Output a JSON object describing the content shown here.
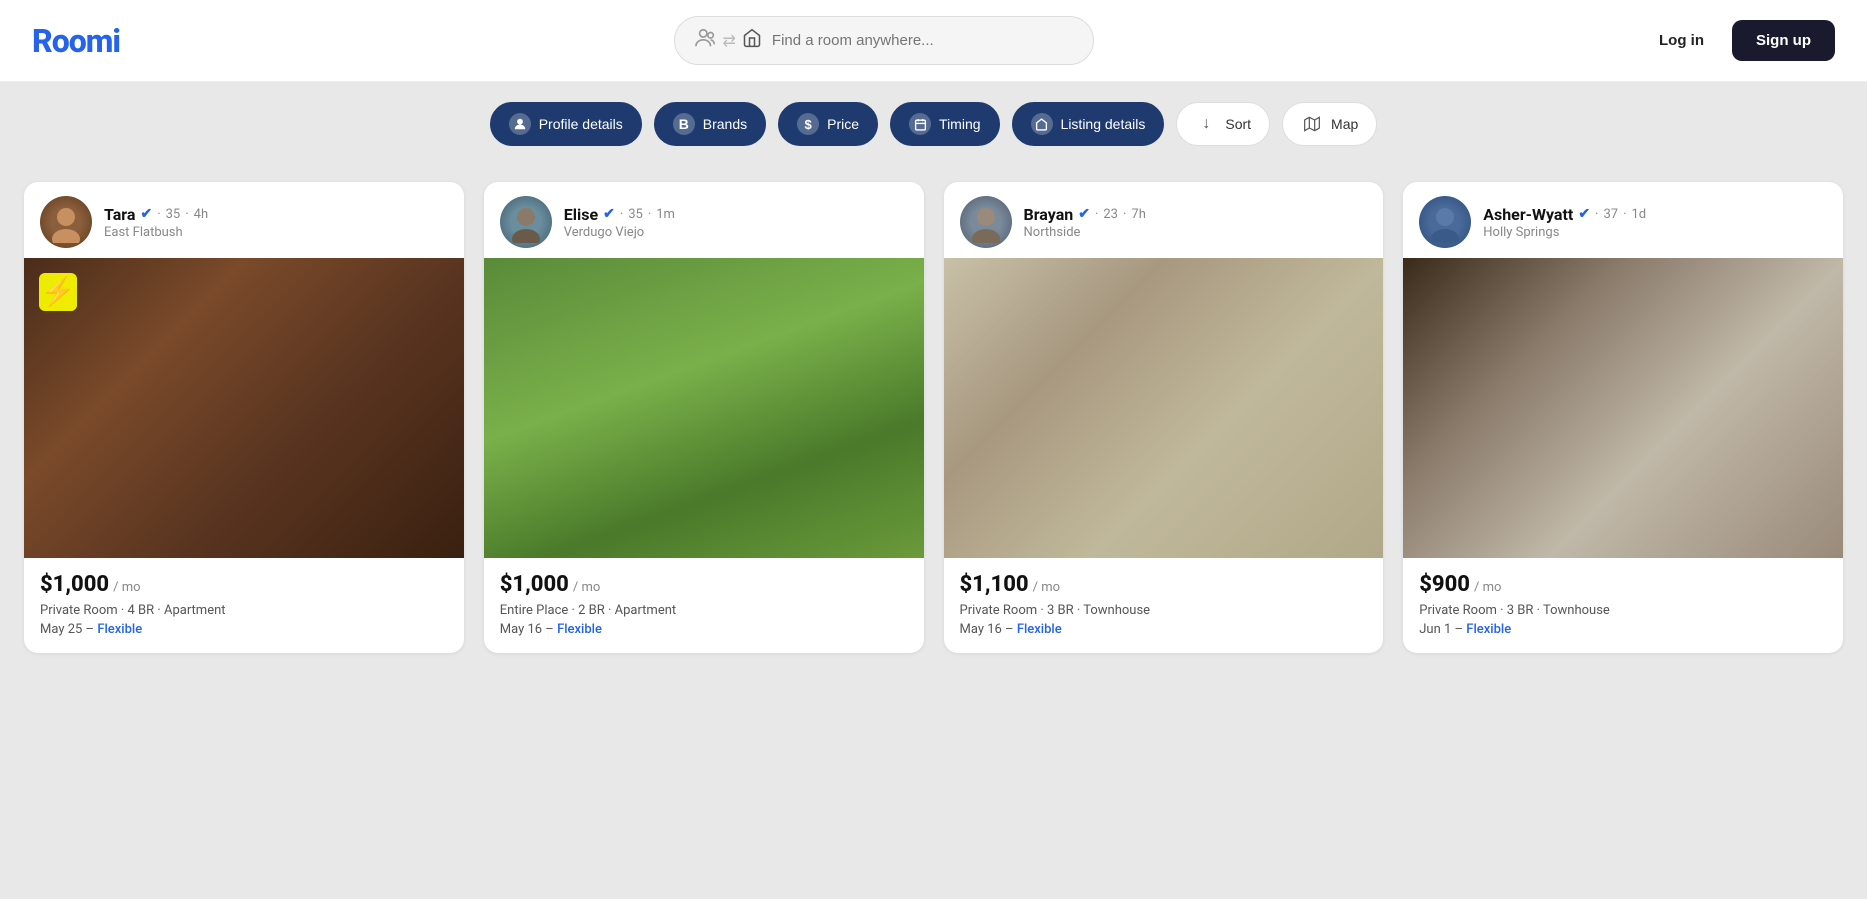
{
  "header": {
    "logo": "Roomi",
    "search_placeholder": "Find a room anywhere...",
    "login_label": "Log in",
    "signup_label": "Sign up"
  },
  "filters": [
    {
      "id": "profile",
      "label": "Profile details",
      "icon": "👤",
      "active": true
    },
    {
      "id": "brands",
      "label": "Brands",
      "icon": "B",
      "active": true
    },
    {
      "id": "price",
      "label": "Price",
      "icon": "$",
      "active": true
    },
    {
      "id": "timing",
      "label": "Timing",
      "icon": "📅",
      "active": true
    },
    {
      "id": "listing",
      "label": "Listing details",
      "icon": "🏠",
      "active": true
    },
    {
      "id": "sort",
      "label": "Sort",
      "icon": "↓",
      "active": false
    },
    {
      "id": "map",
      "label": "Map",
      "icon": "🗺",
      "active": false
    }
  ],
  "listings": [
    {
      "id": "tara",
      "name": "Tara",
      "verified": true,
      "age": "35",
      "time_ago": "4h",
      "location": "East Flatbush",
      "price": "$1,000",
      "period": "/ mo",
      "type": "Private Room · 4 BR · Apartment",
      "date": "May 25",
      "flexible": "Flexible",
      "img_class": "img-tara",
      "avatar_class": "avatar-tara",
      "avatar_emoji": "👩"
    },
    {
      "id": "elise",
      "name": "Elise",
      "verified": true,
      "age": "35",
      "time_ago": "1m",
      "location": "Verdugo Viejo",
      "price": "$1,000",
      "period": "/ mo",
      "type": "Entire Place · 2 BR · Apartment",
      "date": "May 16",
      "flexible": "Flexible",
      "img_class": "img-elise",
      "avatar_class": "avatar-elise",
      "avatar_emoji": "👩"
    },
    {
      "id": "brayan",
      "name": "Brayan",
      "verified": true,
      "age": "23",
      "time_ago": "7h",
      "location": "Northside",
      "price": "$1,100",
      "period": "/ mo",
      "type": "Private Room · 3 BR · Townhouse",
      "date": "May 16",
      "flexible": "Flexible",
      "img_class": "img-brayan",
      "avatar_class": "avatar-brayan",
      "avatar_emoji": "👨"
    },
    {
      "id": "asher-wyatt",
      "name": "Asher-Wyatt",
      "verified": true,
      "age": "37",
      "time_ago": "1d",
      "location": "Holly Springs",
      "price": "$900",
      "period": "/ mo",
      "type": "Private Room · 3 BR · Townhouse",
      "date": "Jun 1",
      "flexible": "Flexible",
      "img_class": "img-asher",
      "avatar_class": "avatar-asher",
      "avatar_emoji": "👨"
    }
  ]
}
